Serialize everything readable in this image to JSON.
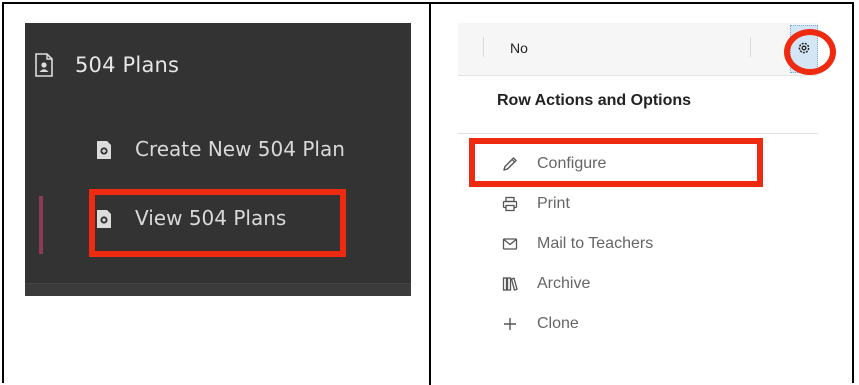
{
  "left": {
    "section_title": "504 Plans",
    "items": [
      {
        "label": "Create New 504 Plan",
        "icon": "plus-document-icon"
      },
      {
        "label": "View 504 Plans",
        "icon": "view-document-icon",
        "active": true
      }
    ]
  },
  "right": {
    "table_cell": "No",
    "gear_icon": "gear-icon",
    "menu_title": "Row Actions and Options",
    "menu_items": [
      {
        "label": "Configure",
        "icon": "pencil-icon"
      },
      {
        "label": "Print",
        "icon": "printer-icon"
      },
      {
        "label": "Mail to Teachers",
        "icon": "mail-icon"
      },
      {
        "label": "Archive",
        "icon": "archive-icon"
      },
      {
        "label": "Clone",
        "icon": "plus-icon"
      }
    ]
  },
  "colors": {
    "sidebar_bg": "#333333",
    "active_indicator": "#8c3a58",
    "highlight": "#ee2a10",
    "gear_cell_bg": "#d4e6f5"
  }
}
